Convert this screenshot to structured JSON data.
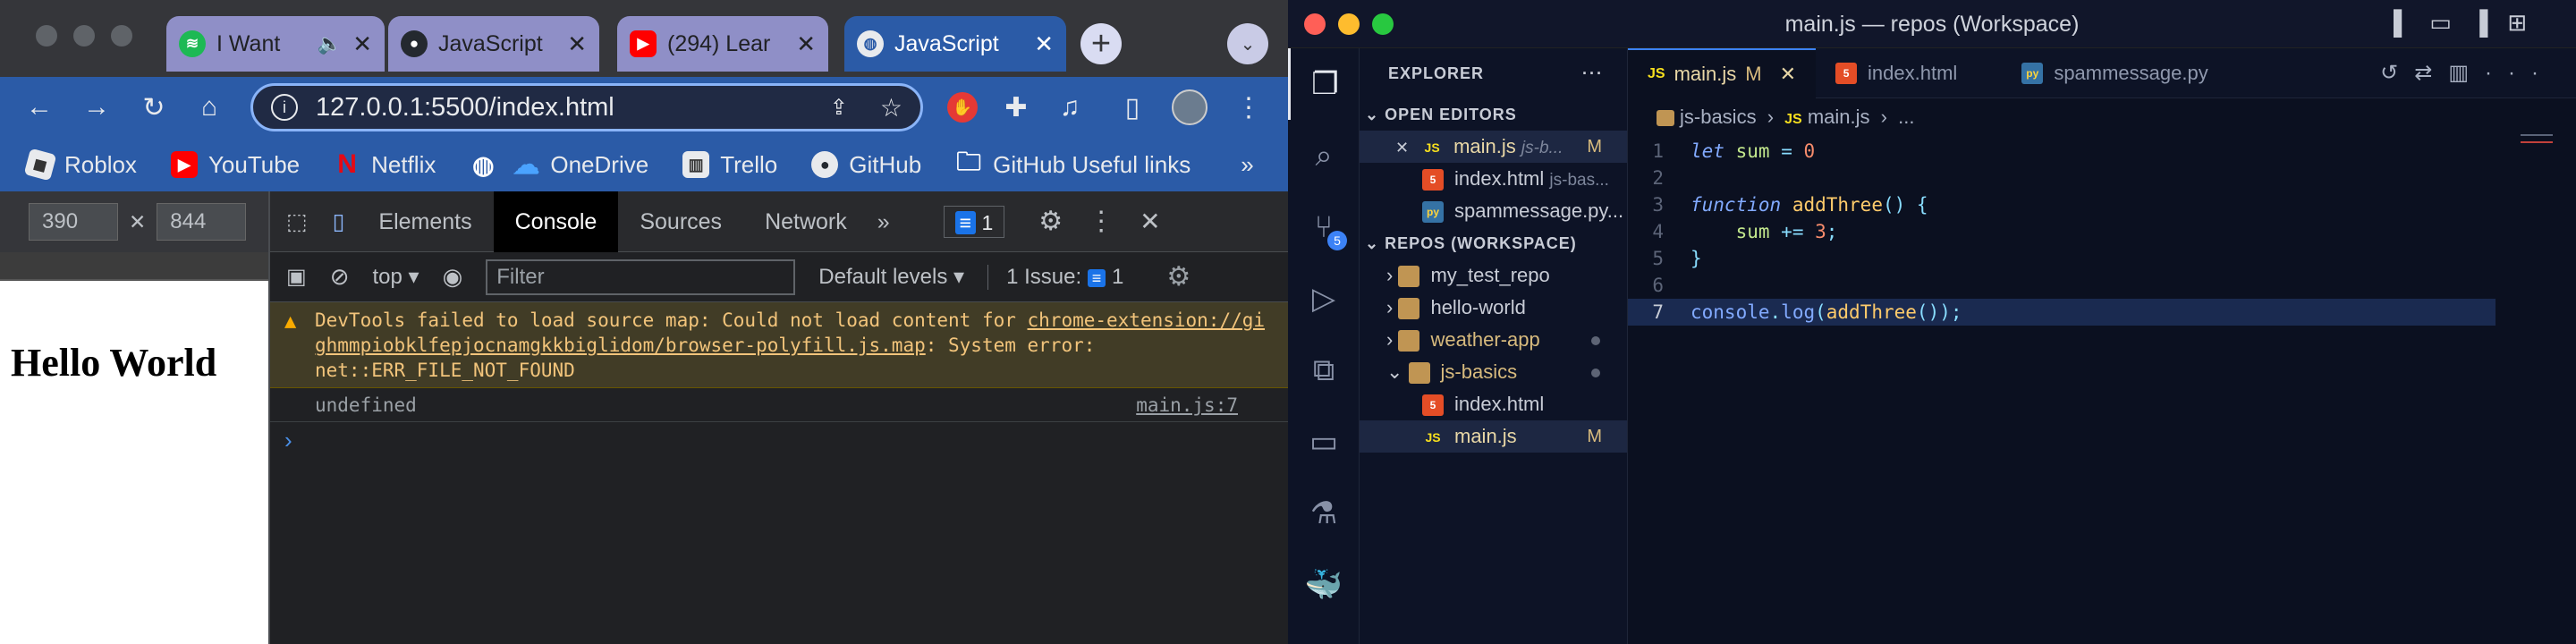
{
  "chrome": {
    "tabs": [
      {
        "title": "I Want",
        "icon": "spotify-icon",
        "muted": true
      },
      {
        "title": "JavaScript",
        "icon": "github-icon"
      },
      {
        "title": "(294) Lear",
        "icon": "youtube-icon"
      },
      {
        "title": "JavaScript",
        "icon": "globe-icon",
        "active": true
      }
    ],
    "address": "127.0.0.1:5500/index.html",
    "bookmarks": [
      "Roblox",
      "YouTube",
      "Netflix",
      "OneDrive",
      "Trello",
      "GitHub",
      "GitHub Useful links"
    ],
    "viewport": {
      "width": "390",
      "height": "844"
    },
    "page_heading": "Hello World",
    "devtools": {
      "tabs": [
        "Elements",
        "Console",
        "Sources",
        "Network"
      ],
      "active_tab": "Console",
      "issue_count": "1",
      "context": "top",
      "filter_placeholder": "Filter",
      "levels": "Default levels",
      "issues_label": "1 Issue:",
      "warning": {
        "prefix": "DevTools failed to load source map: Could not load content for ",
        "link": "chrome-extension://gighmmpiobklfepjocnamgkkbiglidom/browser-polyfill.js.map",
        "suffix": ": System error: net::ERR_FILE_NOT_FOUND"
      },
      "log_value": "undefined",
      "log_source": "main.js:7",
      "prompt": "›"
    }
  },
  "vscode": {
    "title": "main.js — repos (Workspace)",
    "explorer_title": "EXPLORER",
    "open_editors_label": "OPEN EDITORS",
    "open_editors": [
      {
        "name": "main.js",
        "detail": "js-b...",
        "badge": "M",
        "type": "js"
      },
      {
        "name": "index.html",
        "detail": "js-bas...",
        "type": "html"
      },
      {
        "name": "spammessage.py...",
        "type": "py"
      }
    ],
    "workspace_label": "REPOS (WORKSPACE)",
    "tree": [
      {
        "name": "my_test_repo",
        "type": "folder"
      },
      {
        "name": "hello-world",
        "type": "folder"
      },
      {
        "name": "weather-app",
        "type": "folder",
        "dot": true
      },
      {
        "name": "js-basics",
        "type": "folder",
        "open": true,
        "dot": true
      },
      {
        "name": "index.html",
        "type": "html",
        "child": true
      },
      {
        "name": "main.js",
        "type": "js",
        "child": true,
        "badge": "M"
      }
    ],
    "scm_badge": "5",
    "editor_tabs": [
      {
        "name": "main.js",
        "badge": "M",
        "type": "js",
        "active": true
      },
      {
        "name": "index.html",
        "type": "html"
      },
      {
        "name": "spammessage.py",
        "type": "py"
      }
    ],
    "breadcrumb": [
      "js-basics",
      "main.js",
      "..."
    ],
    "code": [
      {
        "n": "1",
        "text": "let sum = 0"
      },
      {
        "n": "2",
        "text": ""
      },
      {
        "n": "3",
        "text": "function addThree() {"
      },
      {
        "n": "4",
        "text": "    sum += 3;"
      },
      {
        "n": "5",
        "text": "}"
      },
      {
        "n": "6",
        "text": ""
      },
      {
        "n": "7",
        "text": "console.log(addThree());"
      }
    ]
  }
}
